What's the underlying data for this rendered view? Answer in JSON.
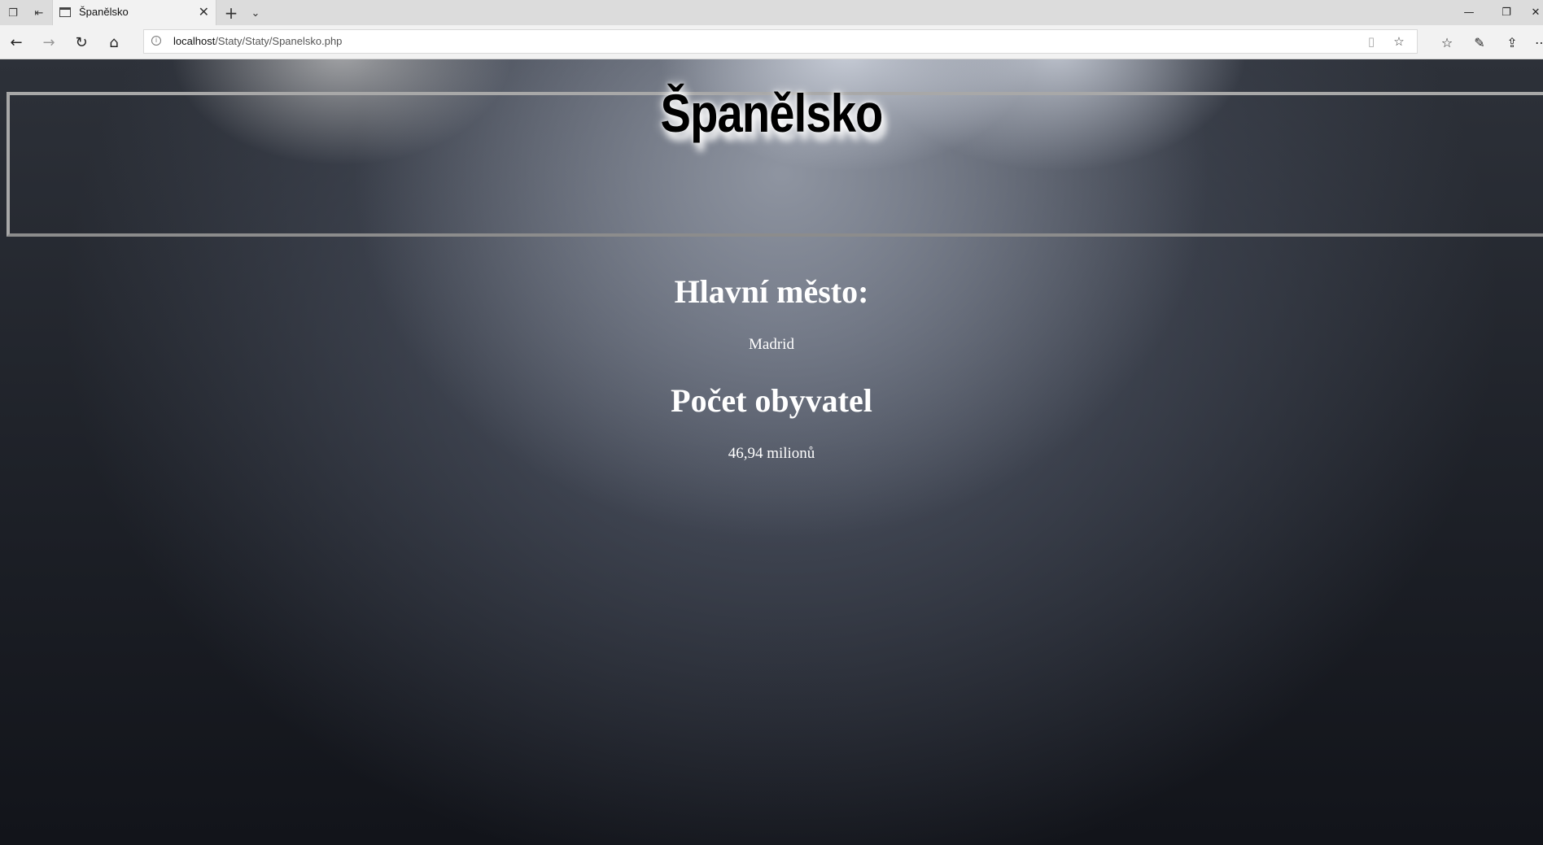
{
  "browser": {
    "tab_title": "Španělsko",
    "url_host": "localhost",
    "url_path": "/Staty/Staty/Spanelsko.php"
  },
  "page": {
    "title": "Španělsko",
    "capital_heading": "Hlavní město:",
    "capital_value": "Madrid",
    "population_heading": "Počet obyvatel",
    "population_value": "46,94 milionů"
  },
  "icons": {
    "tab_actions": [
      "tabs-aside-icon",
      "set-tabs-aside-icon"
    ],
    "nav": [
      "back-icon",
      "forward-icon",
      "refresh-icon",
      "home-icon"
    ],
    "address_right": [
      "reading-view-icon",
      "favorite-star-icon"
    ],
    "toolbar_right": [
      "favorites-hub-icon",
      "pen-icon",
      "share-icon",
      "more-icon"
    ]
  },
  "colors": {
    "text": "#ffffff",
    "title_text": "#000000",
    "header_border": "#a8a8a8"
  }
}
